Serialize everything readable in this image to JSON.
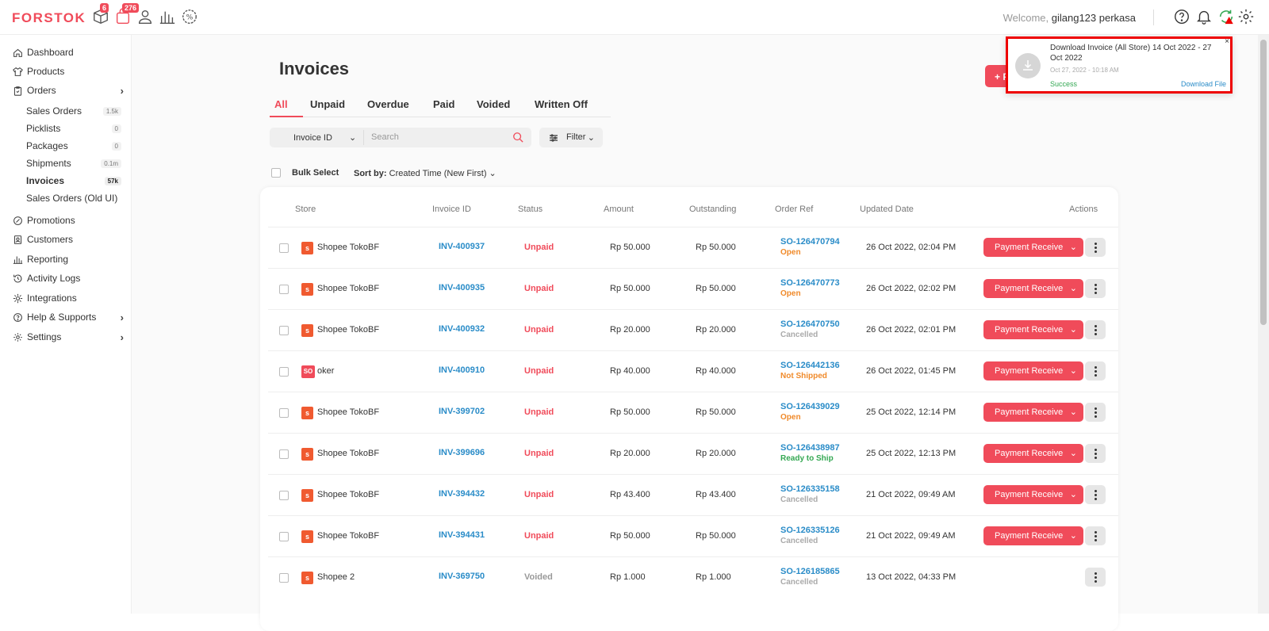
{
  "app": {
    "logo": "FORSTOK"
  },
  "topbar": {
    "badge_box": "6",
    "badge_bag": "276",
    "welcome_prefix": "Welcome,",
    "user_name": "gilang123 perkasa"
  },
  "sidebar": {
    "items": [
      {
        "label": "Dashboard",
        "icon": "home-icon"
      },
      {
        "label": "Products",
        "icon": "shirt-icon"
      },
      {
        "label": "Orders",
        "icon": "clipboard-icon"
      },
      {
        "label": "Promotions",
        "icon": "promo-icon"
      },
      {
        "label": "Customers",
        "icon": "customers-icon"
      },
      {
        "label": "Reporting",
        "icon": "bar-chart-icon"
      },
      {
        "label": "Activity Logs",
        "icon": "history-icon"
      },
      {
        "label": "Integrations",
        "icon": "integration-icon"
      },
      {
        "label": "Help & Supports",
        "icon": "help-icon"
      },
      {
        "label": "Settings",
        "icon": "gear-icon"
      }
    ],
    "orders_sub": [
      {
        "label": "Sales Orders",
        "count": "1.5k"
      },
      {
        "label": "Picklists",
        "count": "0"
      },
      {
        "label": "Packages",
        "count": "0"
      },
      {
        "label": "Shipments",
        "count": "0.1m"
      },
      {
        "label": "Invoices",
        "count": "57k"
      },
      {
        "label": "Sales Orders (Old UI)",
        "count": ""
      }
    ]
  },
  "page": {
    "title": "Invoices",
    "add_button": "+ Payment Receive",
    "tabs": [
      "All",
      "Unpaid",
      "Overdue",
      "Paid",
      "Voided",
      "Written Off"
    ],
    "search_field": "Invoice ID",
    "search_placeholder": "Search",
    "filter_label": "Filter",
    "bulk_select": "Bulk Select",
    "sort_label": "Sort by:",
    "sort_value": "Created Time (New First)"
  },
  "table": {
    "headers": [
      "Store",
      "Invoice ID",
      "Status",
      "Amount",
      "Outstanding",
      "Order Ref",
      "Updated Date",
      "Actions"
    ],
    "action_label": "Payment Receive",
    "rows": [
      {
        "store": "Shopee TokoBF",
        "store_type": "shopee",
        "invoice": "INV-400937",
        "status": "Unpaid",
        "amount": "Rp 50.000",
        "outstanding": "Rp 50.000",
        "order": "SO-126470794",
        "order_status": "Open",
        "updated": "26 Oct 2022, 02:04 PM",
        "payable": true
      },
      {
        "store": "Shopee TokoBF",
        "store_type": "shopee",
        "invoice": "INV-400935",
        "status": "Unpaid",
        "amount": "Rp 50.000",
        "outstanding": "Rp 50.000",
        "order": "SO-126470773",
        "order_status": "Open",
        "updated": "26 Oct 2022, 02:02 PM",
        "payable": true
      },
      {
        "store": "Shopee TokoBF",
        "store_type": "shopee",
        "invoice": "INV-400932",
        "status": "Unpaid",
        "amount": "Rp 20.000",
        "outstanding": "Rp 20.000",
        "order": "SO-126470750",
        "order_status": "Cancelled",
        "updated": "26 Oct 2022, 02:01 PM",
        "payable": true
      },
      {
        "store": "oker",
        "store_type": "so",
        "store_badge": "SO",
        "invoice": "INV-400910",
        "status": "Unpaid",
        "amount": "Rp 40.000",
        "outstanding": "Rp 40.000",
        "order": "SO-126442136",
        "order_status": "Not Shipped",
        "updated": "26 Oct 2022, 01:45 PM",
        "payable": true
      },
      {
        "store": "Shopee TokoBF",
        "store_type": "shopee",
        "invoice": "INV-399702",
        "status": "Unpaid",
        "amount": "Rp 50.000",
        "outstanding": "Rp 50.000",
        "order": "SO-126439029",
        "order_status": "Open",
        "updated": "25 Oct 2022, 12:14 PM",
        "payable": true
      },
      {
        "store": "Shopee TokoBF",
        "store_type": "shopee",
        "invoice": "INV-399696",
        "status": "Unpaid",
        "amount": "Rp 20.000",
        "outstanding": "Rp 20.000",
        "order": "SO-126438987",
        "order_status": "Ready to Ship",
        "updated": "25 Oct 2022, 12:13 PM",
        "payable": true
      },
      {
        "store": "Shopee TokoBF",
        "store_type": "shopee",
        "invoice": "INV-394432",
        "status": "Unpaid",
        "amount": "Rp 43.400",
        "outstanding": "Rp 43.400",
        "order": "SO-126335158",
        "order_status": "Cancelled",
        "updated": "21 Oct 2022, 09:49 AM",
        "payable": true
      },
      {
        "store": "Shopee TokoBF",
        "store_type": "shopee",
        "invoice": "INV-394431",
        "status": "Unpaid",
        "amount": "Rp 50.000",
        "outstanding": "Rp 50.000",
        "order": "SO-126335126",
        "order_status": "Cancelled",
        "updated": "21 Oct 2022, 09:49 AM",
        "payable": true
      },
      {
        "store": "Shopee 2",
        "store_type": "shopee",
        "invoice": "INV-369750",
        "status": "Voided",
        "amount": "Rp 1.000",
        "outstanding": "Rp 1.000",
        "order": "SO-126185865",
        "order_status": "Cancelled",
        "updated": "13 Oct 2022, 04:33 PM",
        "payable": false
      }
    ]
  },
  "toast": {
    "title": "Download Invoice (All Store) 14 Oct 2022 - 27 Oct 2022",
    "time": "Oct 27, 2022 - 10:18 AM",
    "status": "Success",
    "link": "Download File",
    "close": "×"
  },
  "colors": {
    "accent": "#f04b5a",
    "link": "#2a8cc8",
    "success": "#34a853",
    "warning": "#f08a2a"
  }
}
